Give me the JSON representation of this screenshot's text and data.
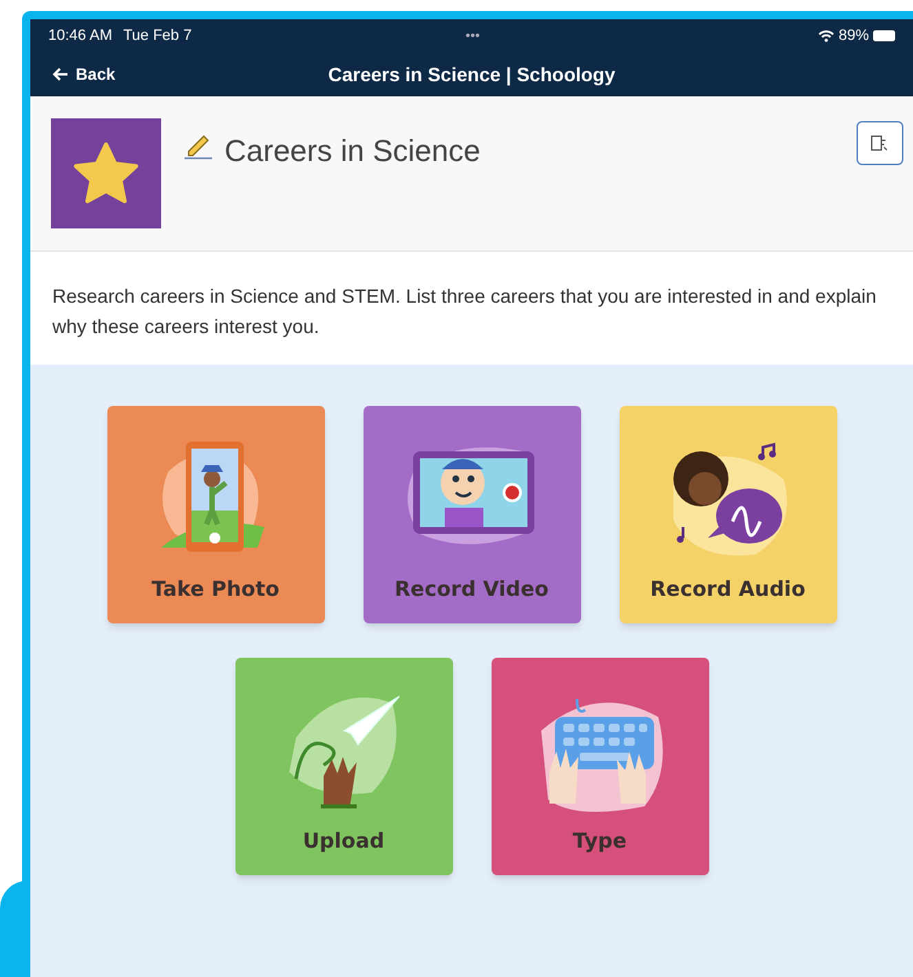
{
  "status_bar": {
    "time": "10:46 AM",
    "date": "Tue Feb 7",
    "dots": "•••",
    "battery": "89%"
  },
  "nav_bar": {
    "back": "Back",
    "title": "Careers in Science | Schoology"
  },
  "assignment": {
    "title": "Careers in Science",
    "description": "Research careers in Science and STEM.  List three careers that you are interested in and explain why these careers interest you."
  },
  "response_options": [
    {
      "kind": "photo",
      "label": "Take Photo",
      "color": "#ec8a55"
    },
    {
      "kind": "video",
      "label": "Record Video",
      "color": "#a36cc6"
    },
    {
      "kind": "audio",
      "label": "Record Audio",
      "color": "#f5d268"
    },
    {
      "kind": "upload",
      "label": "Upload",
      "color": "#7fc45f"
    },
    {
      "kind": "type",
      "label": "Type",
      "color": "#d5507a"
    }
  ]
}
